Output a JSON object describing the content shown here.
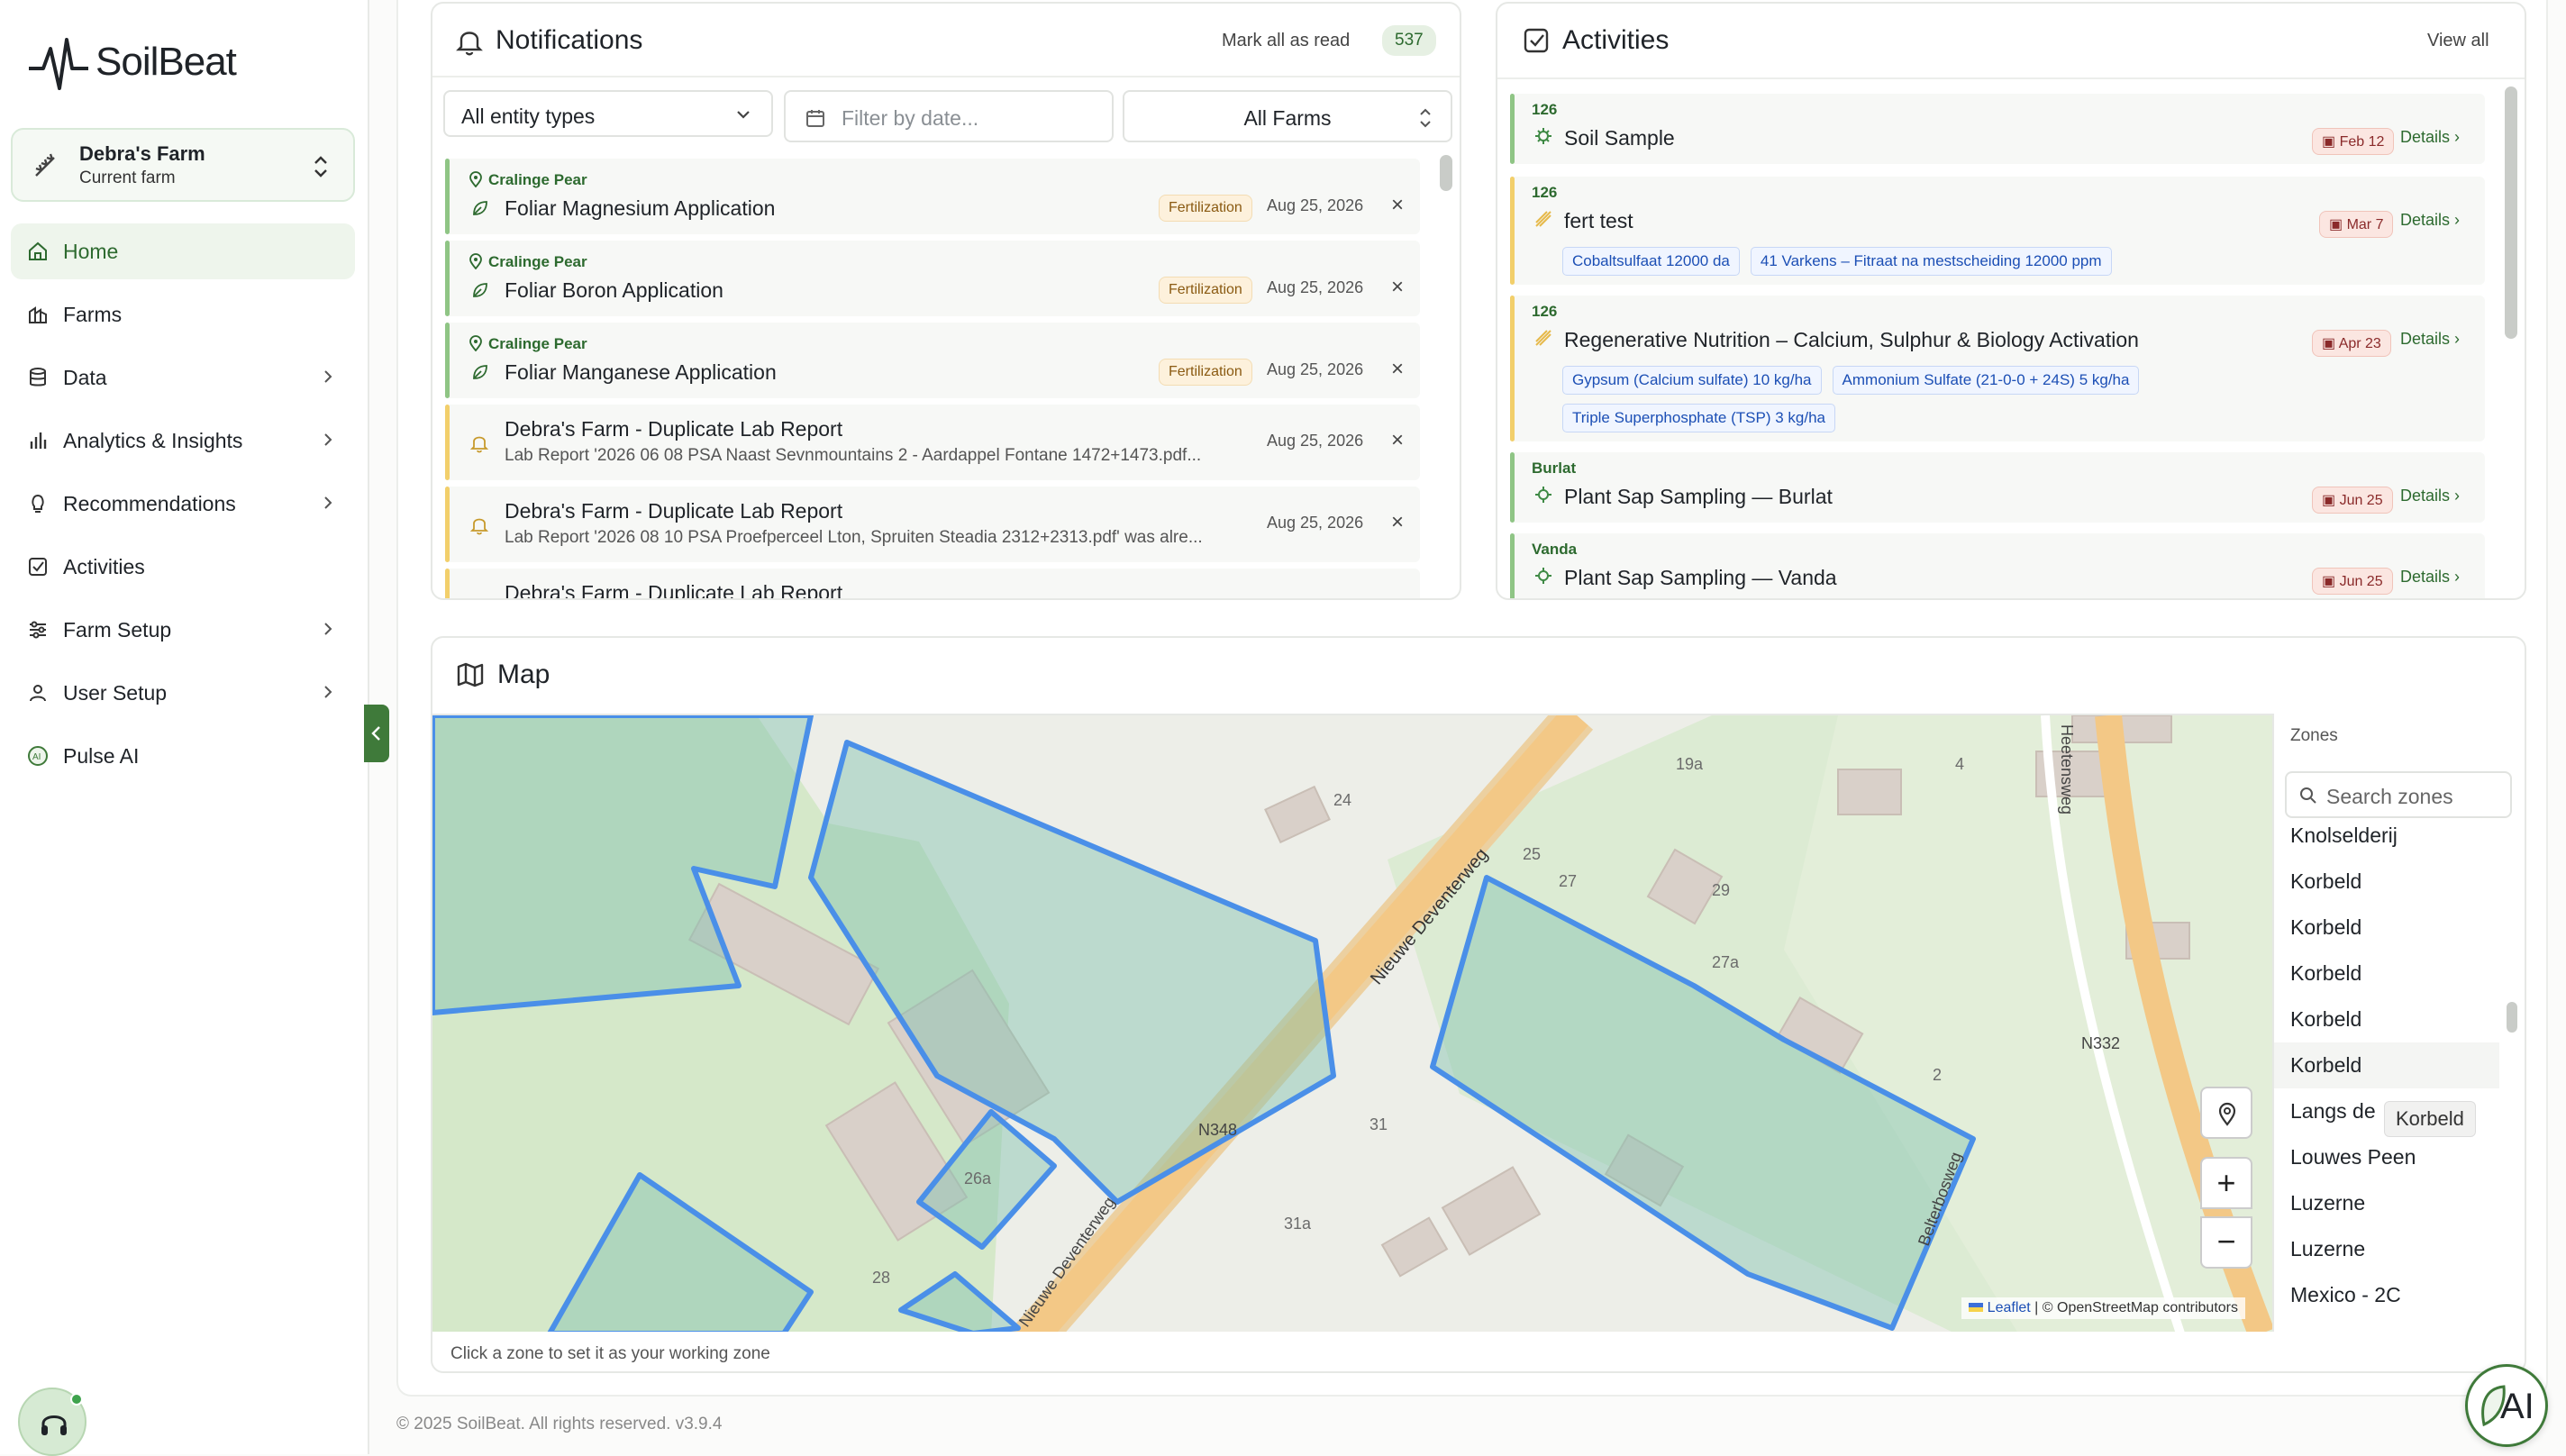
{
  "brand": {
    "name": "SoilBeat"
  },
  "farm_switcher": {
    "name": "Debra's Farm",
    "subtitle": "Current farm"
  },
  "nav": [
    {
      "label": "Home",
      "icon": "home-icon",
      "active": true,
      "chevron": false
    },
    {
      "label": "Farms",
      "icon": "farms-icon",
      "chevron": false
    },
    {
      "label": "Data",
      "icon": "database-icon",
      "chevron": true
    },
    {
      "label": "Analytics & Insights",
      "icon": "chart-icon",
      "chevron": true
    },
    {
      "label": "Recommendations",
      "icon": "lightbulb-icon",
      "chevron": true
    },
    {
      "label": "Activities",
      "icon": "checkbox-icon",
      "chevron": false
    },
    {
      "label": "Farm Setup",
      "icon": "sliders-icon",
      "chevron": true
    },
    {
      "label": "User Setup",
      "icon": "user-icon",
      "chevron": true
    },
    {
      "label": "Pulse AI",
      "icon": "ai-icon",
      "chevron": false
    }
  ],
  "notifications": {
    "title": "Notifications",
    "mark_all": "Mark all as read",
    "count": "537",
    "filters": {
      "entity": "All entity types",
      "date_placeholder": "Filter by date...",
      "farms": "All Farms"
    },
    "items": [
      {
        "farm": "Cralinge Pear",
        "title": "Foliar Magnesium Application",
        "badge": "Fertilization",
        "date": "Aug 25, 2026",
        "type": "green"
      },
      {
        "farm": "Cralinge Pear",
        "title": "Foliar Boron Application",
        "badge": "Fertilization",
        "date": "Aug 25, 2026",
        "type": "green"
      },
      {
        "farm": "Cralinge Pear",
        "title": "Foliar Manganese Application",
        "badge": "Fertilization",
        "date": "Aug 25, 2026",
        "type": "green"
      },
      {
        "title": "Debra's Farm - Duplicate Lab Report",
        "desc": "Lab Report '2026 06 08 PSA Naast Sevnmountains 2 - Aardappel Fontane 1472+1473.pdf...",
        "date": "Aug 25, 2026",
        "type": "yellow"
      },
      {
        "title": "Debra's Farm - Duplicate Lab Report",
        "desc": "Lab Report '2026 08 10 PSA Proefperceel Lton, Spruiten Steadia 2312+2313.pdf' was alre...",
        "date": "Aug 25, 2026",
        "type": "yellow"
      },
      {
        "title": "Debra's Farm - Duplicate Lab Report",
        "type": "yellow"
      }
    ]
  },
  "activities": {
    "title": "Activities",
    "view_all": "View all",
    "items": [
      {
        "tag": "126",
        "title": "Soil Sample",
        "date": "Feb 12",
        "details": "Details",
        "products": []
      },
      {
        "tag": "126",
        "title": "fert test",
        "date": "Mar 7",
        "details": "Details",
        "products": [
          [
            "Cobaltsulfaat",
            "12000 da"
          ],
          [
            "41 Varkens – Fitraat na mestscheiding",
            "12000 ppm"
          ]
        ]
      },
      {
        "tag": "126",
        "title": "Regenerative Nutrition – Calcium, Sulphur & Biology Activation",
        "date": "Apr 23",
        "details": "Details",
        "products": [
          [
            "Gypsum (Calcium sulfate)",
            "10 kg/ha"
          ],
          [
            "Ammonium Sulfate (21-0-0 + 24S)",
            "5 kg/ha"
          ],
          [
            "Triple Superphosphate (TSP)",
            "3 kg/ha"
          ]
        ]
      },
      {
        "tag": "Burlat",
        "title": "Plant Sap Sampling — Burlat",
        "date": "Jun 25",
        "details": "Details",
        "products": []
      },
      {
        "tag": "Vanda",
        "title": "Plant Sap Sampling — Vanda",
        "date": "Jun 25",
        "details": "Details",
        "products": []
      }
    ]
  },
  "map": {
    "title": "Map",
    "hint": "Click a zone to set it as your working zone",
    "attribution": {
      "leaflet": "Leaflet",
      "osm": "© OpenStreetMap contributors"
    },
    "road_labels": [
      "Nieuwe Deventerweg",
      "N348",
      "N332",
      "Heetensweg",
      "Nieuwe Deventerweg",
      "Belterbosweg"
    ],
    "house_numbers": [
      "24",
      "19a",
      "4",
      "25",
      "27",
      "29",
      "27a",
      "2",
      "31",
      "26a",
      "31a",
      "28"
    ],
    "zones_header": "Zones",
    "zones_search_placeholder": "Search zones",
    "zones": [
      "Knolselderij",
      "Korbeld",
      "Korbeld",
      "Korbeld",
      "Korbeld",
      "Korbeld",
      "Langs de",
      "Louwes Peen",
      "Luzerne",
      "Luzerne",
      "Mexico - 2C"
    ],
    "tooltip": "Korbeld"
  },
  "footer": "© 2025 SoilBeat. All rights reserved. v3.9.4",
  "fab": {
    "label": "AI"
  },
  "colors": {
    "accent": "#2d6a2f",
    "zone_outline": "#3b82f6",
    "road": "#f3c886"
  }
}
